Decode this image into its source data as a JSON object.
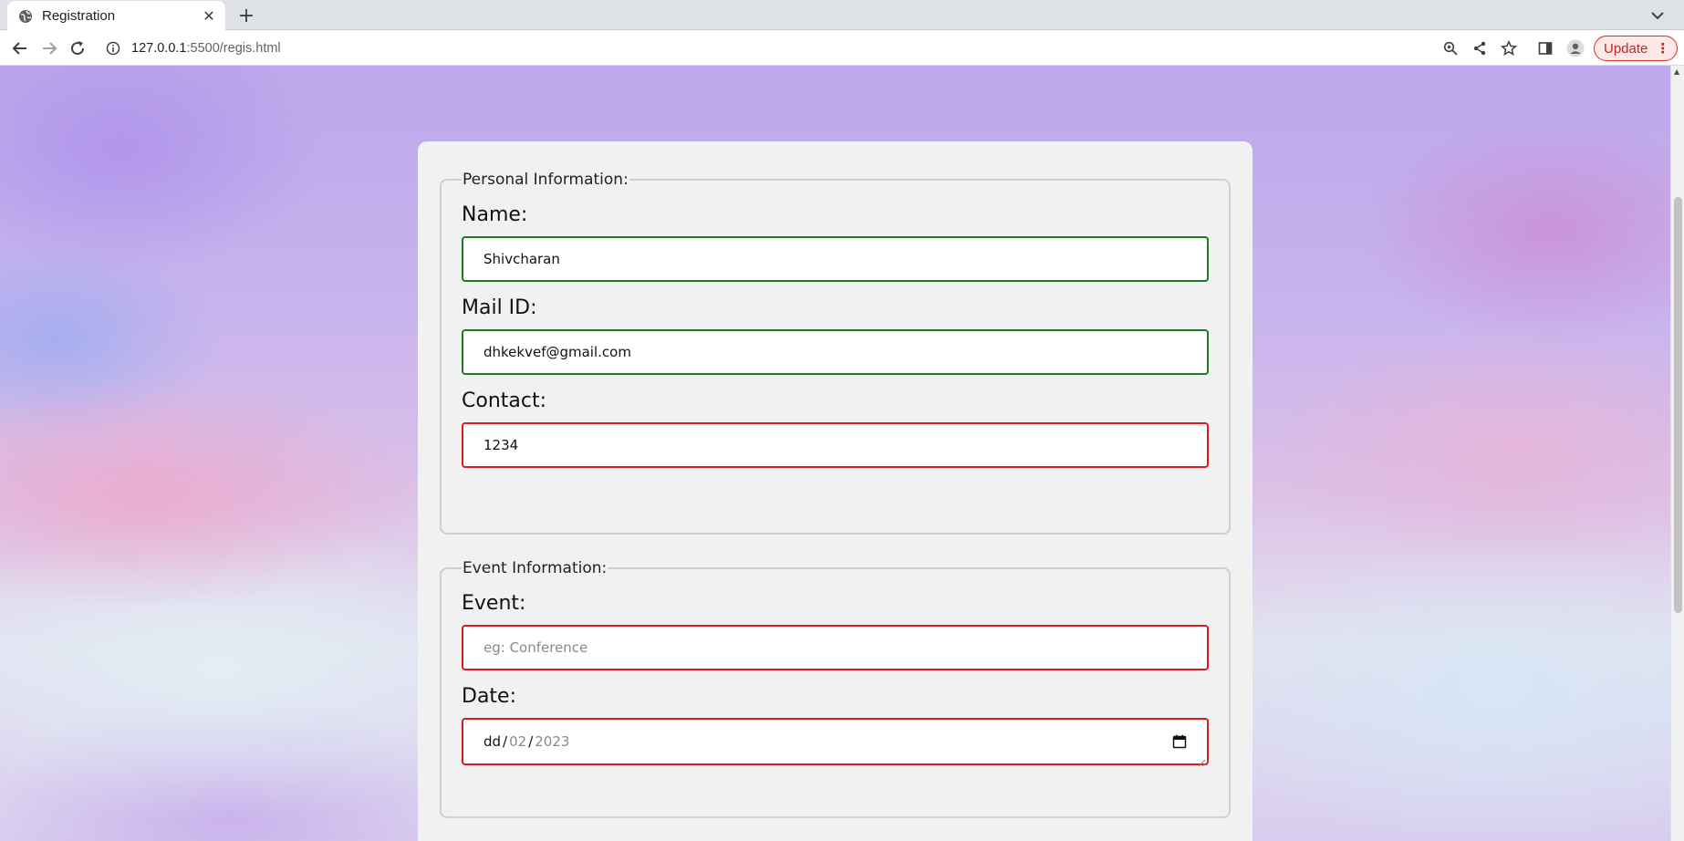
{
  "browser": {
    "tab_title": "Registration",
    "url_host": "127.0.0.1",
    "url_path": ":5500/regis.html",
    "update_label": "Update"
  },
  "form": {
    "personal": {
      "legend": "Personal Information:",
      "name_label": "Name:",
      "name_value": "Shivcharan",
      "mail_label": "Mail ID:",
      "mail_value": "dhkekvef@gmail.com",
      "contact_label": "Contact:",
      "contact_value": "1234"
    },
    "event": {
      "legend": "Event Information:",
      "event_label": "Event:",
      "event_placeholder": "eg: Conference",
      "date_label": "Date:",
      "date_day": "dd",
      "date_sep": "/",
      "date_month": "02",
      "date_year": "2023"
    }
  },
  "colors": {
    "valid_border": "#1e7a1e",
    "invalid_border": "#d51d1d",
    "card_bg": "#f1f1f1",
    "update_accent": "#d93025"
  }
}
